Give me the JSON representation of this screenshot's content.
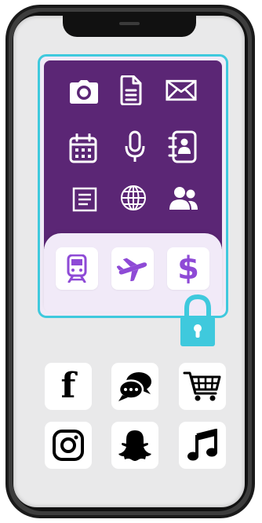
{
  "device": {
    "name": "smartphone"
  },
  "colors": {
    "vault_frame": "#3fc9dd",
    "vault_background": "#5b2675",
    "vault_tray": "#f1eaf8",
    "accent_icon": "#8e4ad6",
    "lock": "#3fc9dd",
    "screen": "#e9e9ea"
  },
  "vault": {
    "locked": true,
    "icons": [
      "camera-icon",
      "document-icon",
      "mail-icon",
      "calendar-icon",
      "microphone-icon",
      "contacts-book-icon",
      "notes-icon",
      "globe-icon",
      "people-icon"
    ],
    "tray_icons": [
      "train-icon",
      "airplane-icon",
      "dollar-icon"
    ],
    "dollar_symbol": "$"
  },
  "apps": [
    {
      "name": "facebook",
      "glyph": "f"
    },
    {
      "name": "chat",
      "glyph": ""
    },
    {
      "name": "shopping-cart",
      "glyph": ""
    },
    {
      "name": "instagram",
      "glyph": ""
    },
    {
      "name": "snapchat",
      "glyph": ""
    },
    {
      "name": "music",
      "glyph": ""
    }
  ]
}
